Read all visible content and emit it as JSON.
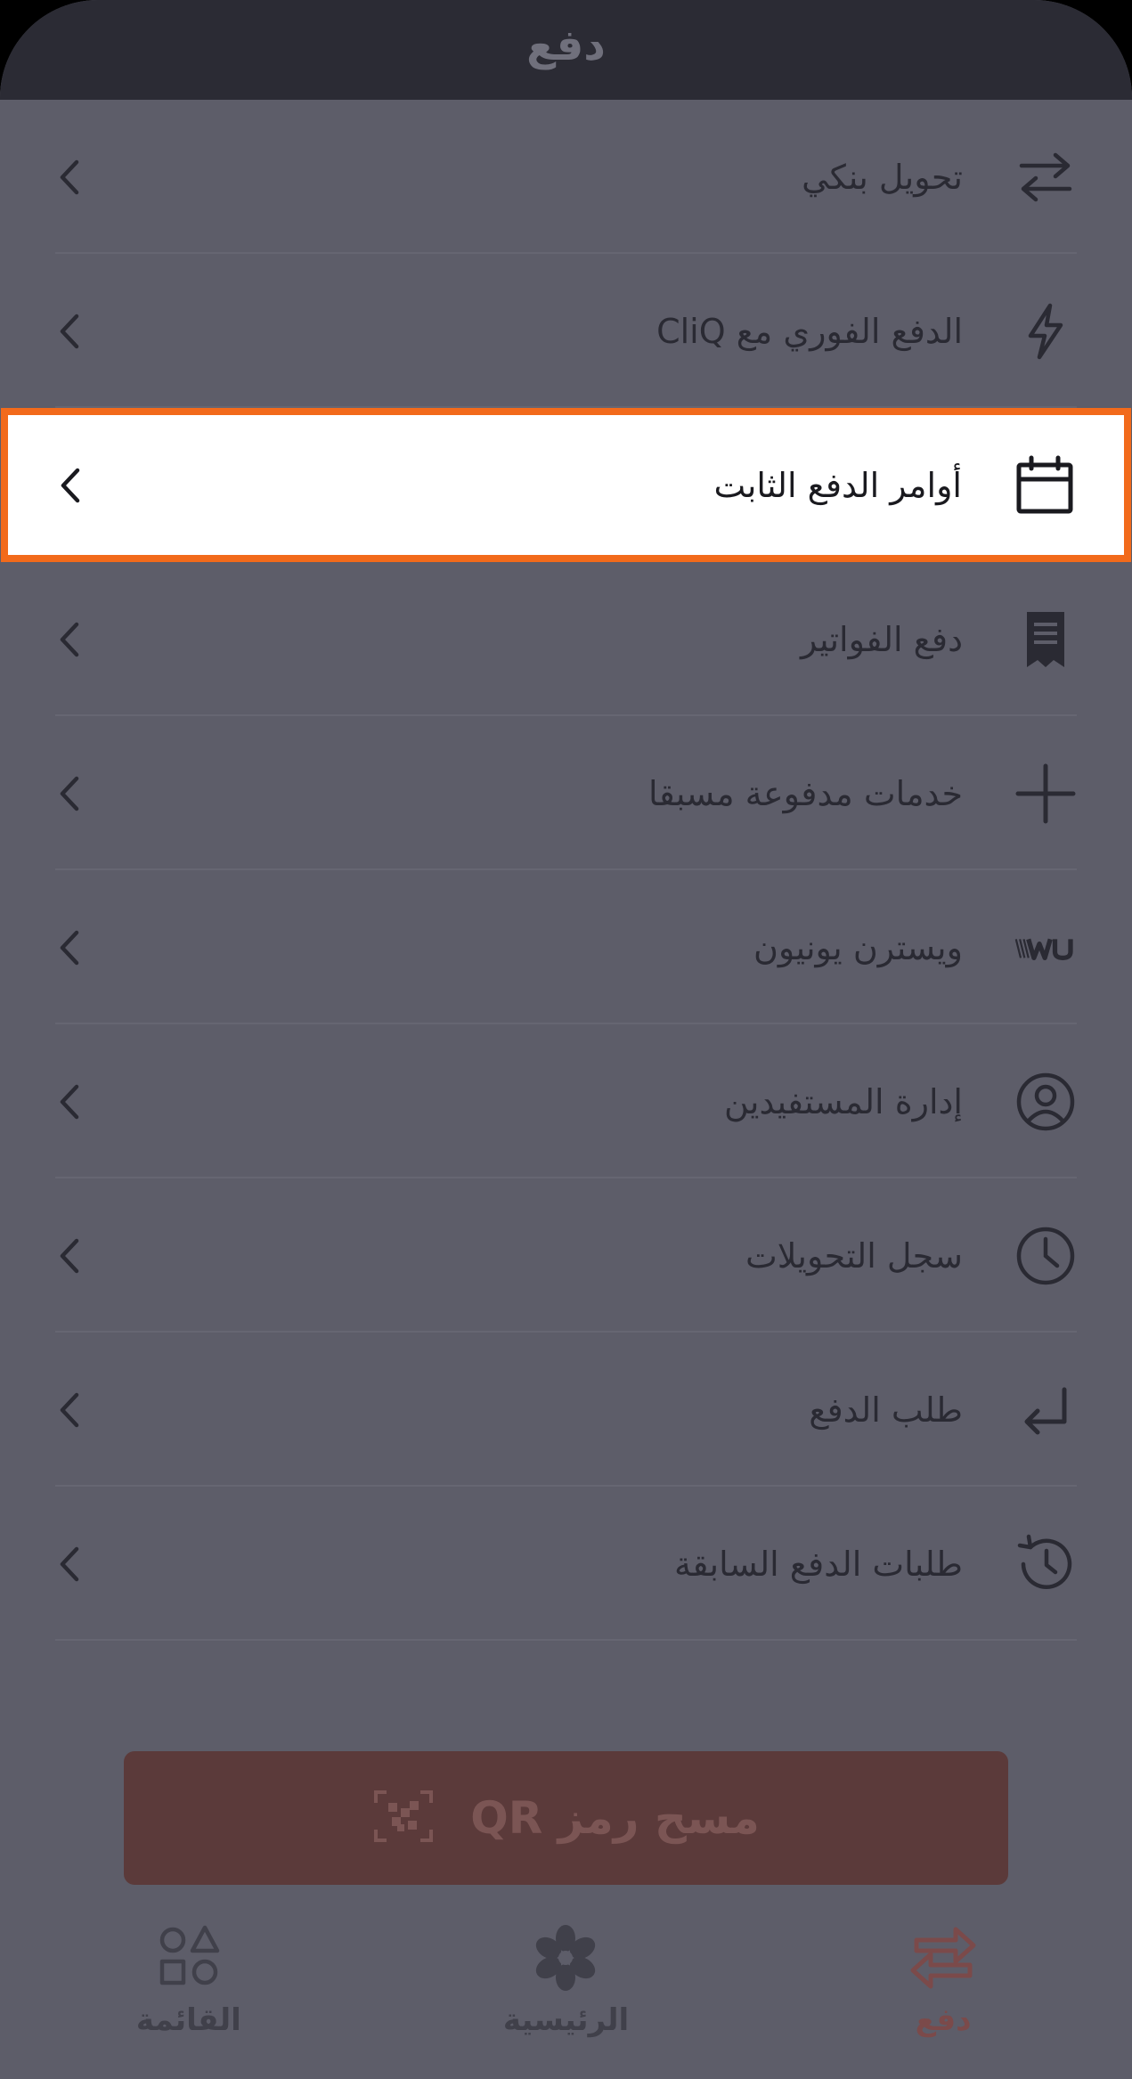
{
  "header": {
    "title": "دفع"
  },
  "menu": {
    "items": [
      {
        "label": "تحويل بنكي",
        "icon": "swap-arrows-icon"
      },
      {
        "label": "الدفع الفوري مع CliQ",
        "icon": "lightning-icon"
      },
      {
        "label": "أوامر الدفع الثابت",
        "icon": "calendar-icon",
        "highlighted": true
      },
      {
        "label": "دفع الفواتير",
        "icon": "receipt-icon"
      },
      {
        "label": "خدمات مدفوعة مسبقا",
        "icon": "plus-icon"
      },
      {
        "label": "ويسترن يونيون",
        "icon": "western-union-icon"
      },
      {
        "label": "إدارة المستفيدين",
        "icon": "user-circle-icon"
      },
      {
        "label": "سجل التحويلات",
        "icon": "clock-icon"
      },
      {
        "label": "طلب الدفع",
        "icon": "return-arrow-icon"
      },
      {
        "label": "طلبات الدفع السابقة",
        "icon": "history-icon"
      }
    ]
  },
  "qr_button": {
    "label": "مسح رمز QR",
    "icon": "qr-scan-icon"
  },
  "tabbar": {
    "tabs": [
      {
        "label": "القائمة",
        "icon": "shapes-icon"
      },
      {
        "label": "الرئيسية",
        "icon": "flower-logo-icon"
      },
      {
        "label": "دفع",
        "icon": "swap-arrows-icon",
        "active": true
      }
    ]
  },
  "colors": {
    "highlight_border": "#f26a1b",
    "overlay": "#5d5d69",
    "accent": "#7b4a4a"
  }
}
